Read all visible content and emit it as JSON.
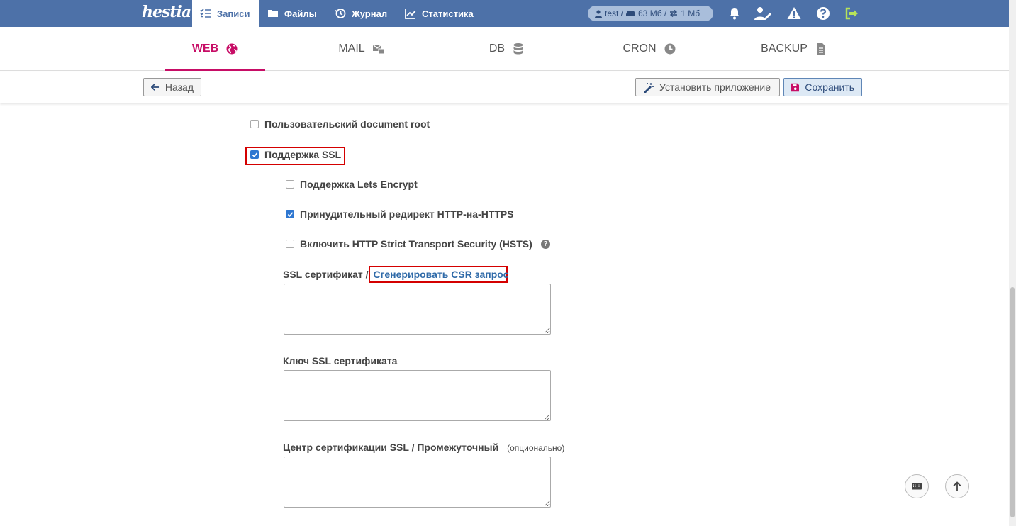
{
  "app": {
    "logo_text": "hestia"
  },
  "topnav": {
    "items": [
      {
        "label": "Записи",
        "icon": "list-icon"
      },
      {
        "label": "Файлы",
        "icon": "folder-icon"
      },
      {
        "label": "Журнал",
        "icon": "history-icon"
      },
      {
        "label": "Статистика",
        "icon": "chart-icon"
      }
    ],
    "usage": {
      "user": "test /",
      "disk": "63 Мб /",
      "bandwidth": "1 Мб"
    }
  },
  "tabs": [
    {
      "label": "WEB",
      "active": true,
      "icon": "globe-icon"
    },
    {
      "label": "MAIL",
      "icon": "mail-icon"
    },
    {
      "label": "DB",
      "icon": "database-icon"
    },
    {
      "label": "CRON",
      "icon": "clock-icon"
    },
    {
      "label": "BACKUP",
      "icon": "file-icon"
    }
  ],
  "toolbar": {
    "back_label": "Назад",
    "install_label": "Установить приложение",
    "save_label": "Сохранить"
  },
  "form": {
    "custom_docroot": {
      "label": "Пользовательский document root",
      "checked": false
    },
    "ssl_support": {
      "label": "Поддержка SSL",
      "checked": true
    },
    "letsencrypt": {
      "label": "Поддержка Lets Encrypt",
      "checked": false
    },
    "force_https": {
      "label": "Принудительный редирект HTTP-на-HTTPS",
      "checked": true
    },
    "hsts": {
      "label": "Включить HTTP Strict Transport Security (HSTS)",
      "checked": false
    },
    "ssl_cert": {
      "label": "SSL сертификат /",
      "link": "Сгенерировать CSR запрос",
      "value": ""
    },
    "ssl_key": {
      "label": "Ключ SSL сертификата",
      "value": ""
    },
    "ssl_ca": {
      "label": "Центр сертификации SSL / Промежуточный",
      "optional": "(опционально)",
      "value": ""
    }
  },
  "colors": {
    "topbar": "#4d71a8",
    "accent": "#c70d66",
    "link": "#2f6aa8",
    "highlight": "#d40000"
  }
}
